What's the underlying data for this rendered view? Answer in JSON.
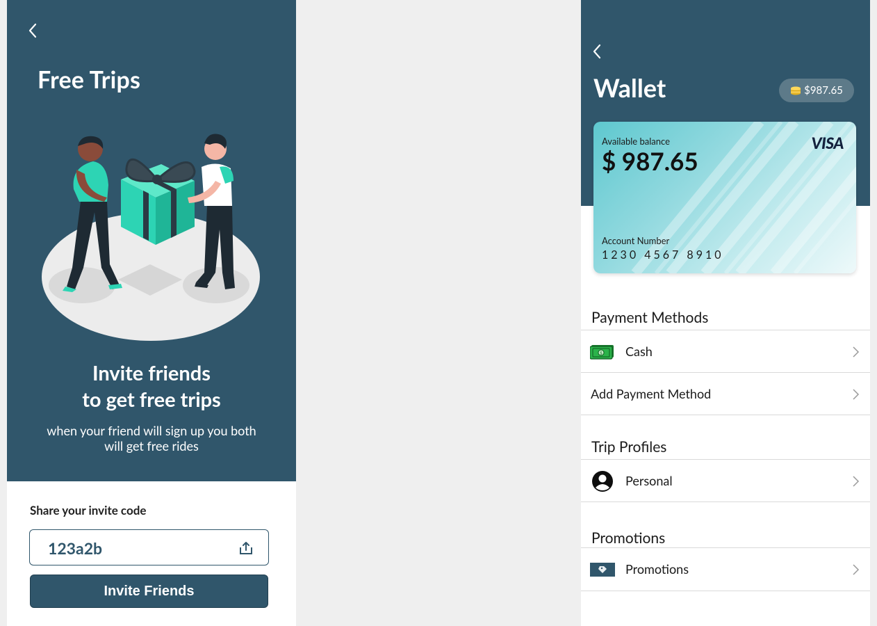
{
  "free_trips": {
    "title": "Free Trips",
    "headline_line1": "Invite friends",
    "headline_line2": "to get free trips",
    "subtext_line1": "when your friend will sign up you both",
    "subtext_line2": "will get free rides",
    "share_label": "Share your invite code",
    "invite_code": "123a2b",
    "invite_button": "Invite Friends",
    "colors": {
      "primary": "#30566b",
      "accent": "#2dd4b4"
    }
  },
  "wallet": {
    "title": "Wallet",
    "balance_pill": "$987.65",
    "card": {
      "available_label": "Available balance",
      "amount": "$ 987.65",
      "brand": "VISA",
      "account_label": "Account Number",
      "account_number": "1230 4567 8910"
    },
    "sections": {
      "payment_methods": "Payment Methods",
      "trip_profiles": "Trip Profiles",
      "promotions": "Promotions"
    },
    "rows": {
      "cash": {
        "label": "Cash",
        "icon": "cash-icon"
      },
      "add_payment": {
        "label": "Add Payment Method"
      },
      "personal": {
        "label": "Personal",
        "icon": "person-icon"
      },
      "promotions": {
        "label": "Promotions",
        "icon": "promo-tag-icon"
      }
    }
  }
}
